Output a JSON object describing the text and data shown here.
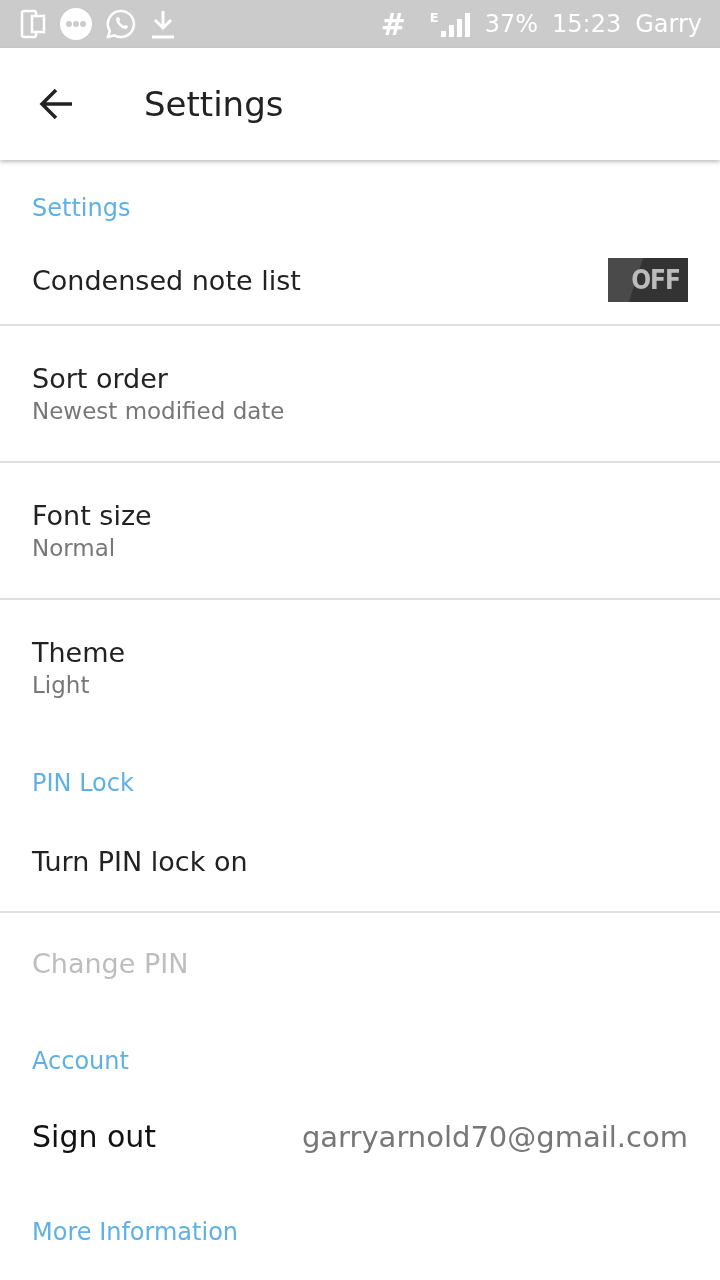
{
  "status_bar": {
    "network_type": "E",
    "hash": "#",
    "battery": "37%",
    "time": "15:23",
    "carrier": "Garry"
  },
  "toolbar": {
    "title": "Settings"
  },
  "sections": [
    {
      "header": "Settings",
      "items": [
        {
          "kind": "toggle",
          "title": "Condensed note list",
          "on": false,
          "switch_label": "OFF"
        },
        {
          "kind": "pref",
          "title": "Sort order",
          "summary": "Newest modified date"
        },
        {
          "kind": "pref",
          "title": "Font size",
          "summary": "Normal"
        },
        {
          "kind": "pref",
          "title": "Theme",
          "summary": "Light"
        }
      ]
    },
    {
      "header": "PIN Lock",
      "items": [
        {
          "kind": "plain",
          "title": "Turn PIN lock on",
          "disabled": false
        },
        {
          "kind": "plain",
          "title": "Change PIN",
          "disabled": true
        }
      ]
    },
    {
      "header": "Account",
      "items": [
        {
          "kind": "account",
          "title": "Sign out",
          "value": "garryarnold70@gmail.com"
        }
      ]
    },
    {
      "header": "More Information"
    }
  ]
}
